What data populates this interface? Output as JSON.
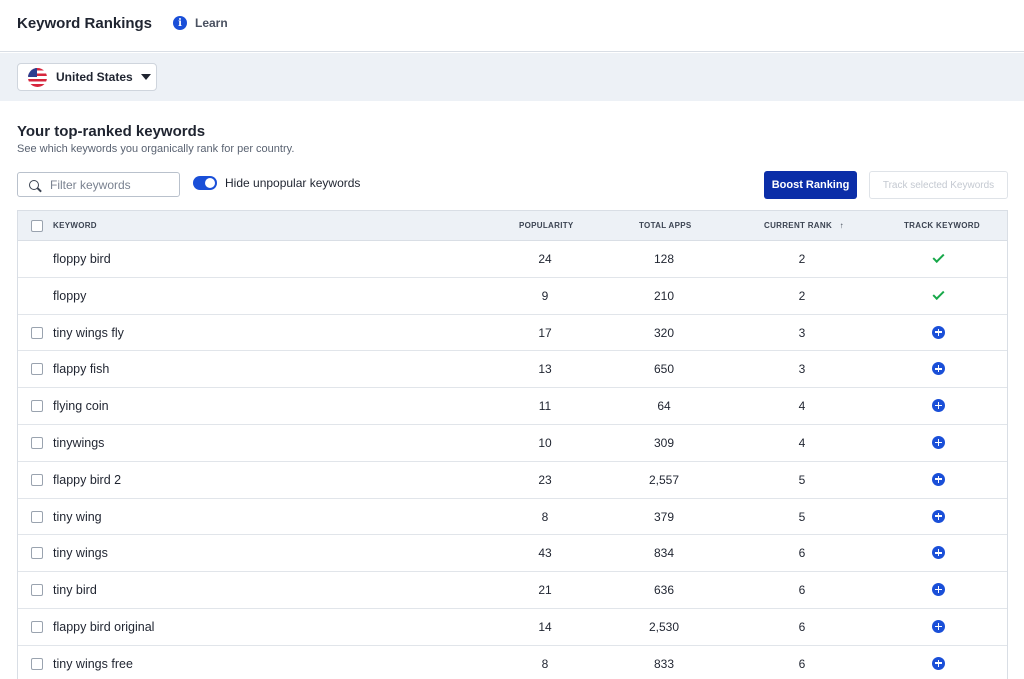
{
  "header": {
    "title": "Keyword Rankings",
    "learn_label": "Learn"
  },
  "country": {
    "selected": "United States",
    "flag_icon": "us-flag-icon"
  },
  "section": {
    "title": "Your top-ranked keywords",
    "subtitle": "See which keywords you organically rank for per country."
  },
  "toolbar": {
    "filter_placeholder": "Filter keywords",
    "toggle_label": "Hide unpopular keywords",
    "toggle_on": true,
    "boost_label": "Boost Ranking",
    "track_selected_label": "Track selected Keywords"
  },
  "table": {
    "columns": {
      "keyword": "KEYWORD",
      "popularity": "POPULARITY",
      "total_apps": "TOTAL APPS",
      "current_rank": "CURRENT RANK",
      "track_keyword": "TRACK KEYWORD"
    },
    "sort_icon": "arrow-up-icon",
    "rows": [
      {
        "keyword": "floppy bird",
        "popularity": "24",
        "total_apps": "128",
        "rank": "2",
        "tracked": true
      },
      {
        "keyword": "floppy",
        "popularity": "9",
        "total_apps": "210",
        "rank": "2",
        "tracked": true
      },
      {
        "keyword": "tiny wings fly",
        "popularity": "17",
        "total_apps": "320",
        "rank": "3",
        "tracked": false
      },
      {
        "keyword": "flappy fish",
        "popularity": "13",
        "total_apps": "650",
        "rank": "3",
        "tracked": false
      },
      {
        "keyword": "flying coin",
        "popularity": "11",
        "total_apps": "64",
        "rank": "4",
        "tracked": false
      },
      {
        "keyword": "tinywings",
        "popularity": "10",
        "total_apps": "309",
        "rank": "4",
        "tracked": false
      },
      {
        "keyword": "flappy bird 2",
        "popularity": "23",
        "total_apps": "2,557",
        "rank": "5",
        "tracked": false
      },
      {
        "keyword": "tiny wing",
        "popularity": "8",
        "total_apps": "379",
        "rank": "5",
        "tracked": false
      },
      {
        "keyword": "tiny wings",
        "popularity": "43",
        "total_apps": "834",
        "rank": "6",
        "tracked": false
      },
      {
        "keyword": "tiny bird",
        "popularity": "21",
        "total_apps": "636",
        "rank": "6",
        "tracked": false
      },
      {
        "keyword": "flappy bird original",
        "popularity": "14",
        "total_apps": "2,530",
        "rank": "6",
        "tracked": false
      },
      {
        "keyword": "tiny wings free",
        "popularity": "8",
        "total_apps": "833",
        "rank": "6",
        "tracked": false
      }
    ]
  },
  "colors": {
    "accent": "#1a4fd8",
    "primary_button": "#0b2ea8",
    "success": "#18a84a"
  }
}
